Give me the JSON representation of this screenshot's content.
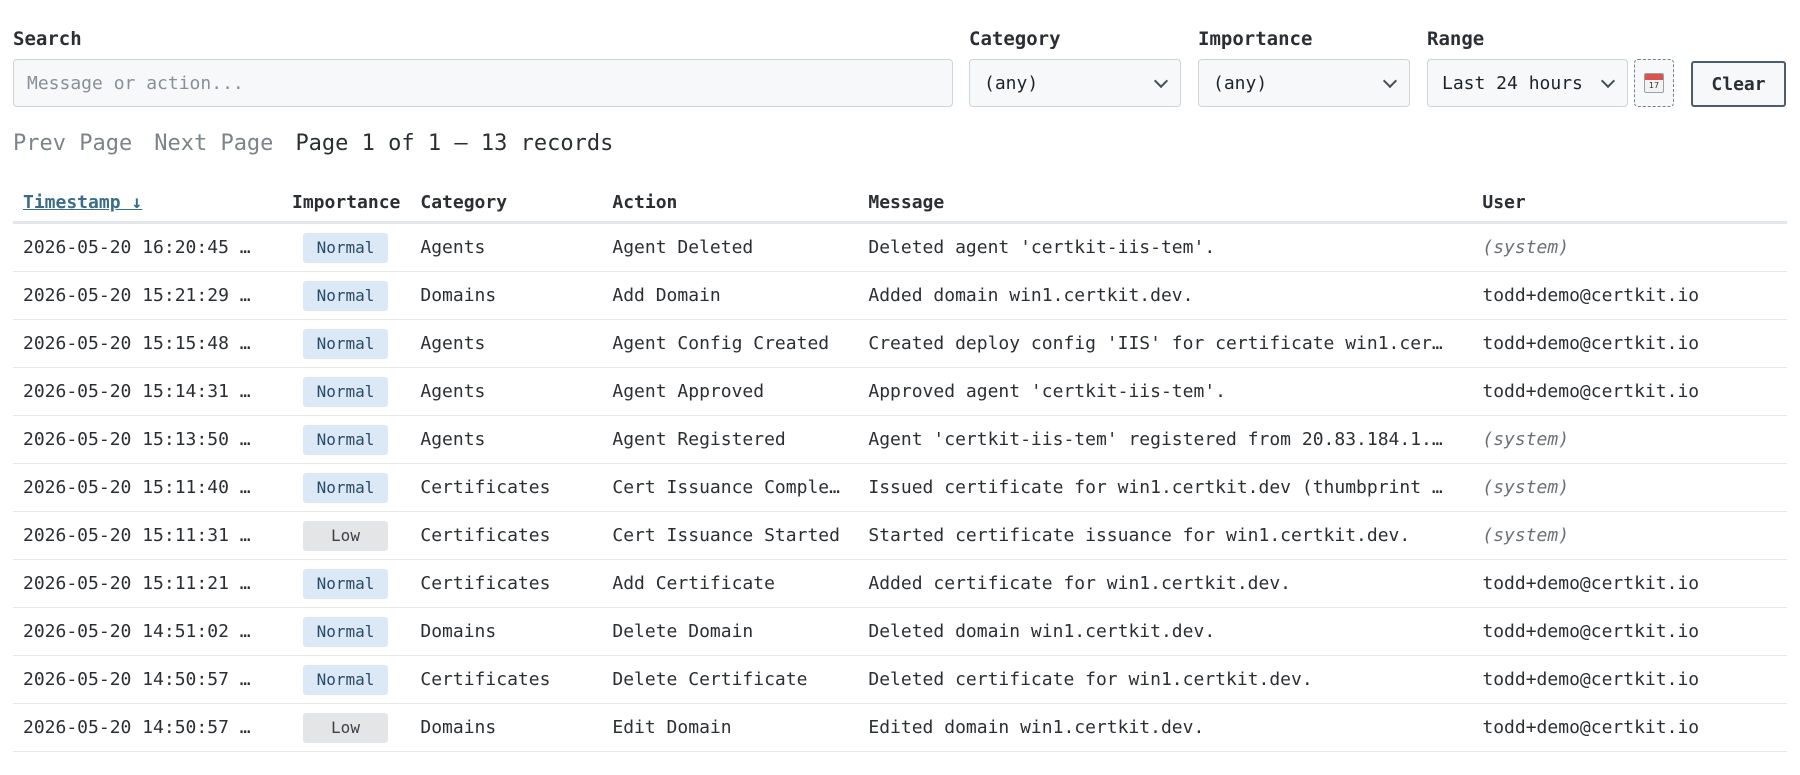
{
  "filters": {
    "search": {
      "label": "Search",
      "placeholder": "Message or action...",
      "value": ""
    },
    "category": {
      "label": "Category",
      "value": "(any)"
    },
    "importance": {
      "label": "Importance",
      "value": "(any)"
    },
    "range": {
      "label": "Range",
      "value": "Last 24 hours"
    },
    "calendar_icon": "calendar-icon",
    "calendar_day": "17",
    "clear_label": "Clear"
  },
  "pager": {
    "prev_label": "Prev Page",
    "next_label": "Next Page",
    "info": "Page 1 of 1 — 13 records"
  },
  "table": {
    "columns": [
      "Timestamp ↓",
      "Importance",
      "Category",
      "Action",
      "Message",
      "User"
    ],
    "rows": [
      {
        "timestamp": "2026-05-20 16:20:45 …",
        "importance": "Normal",
        "category": "Agents",
        "action": "Agent Deleted",
        "message": "Deleted agent 'certkit-iis-tem'.",
        "user": "(system)"
      },
      {
        "timestamp": "2026-05-20 15:21:29 …",
        "importance": "Normal",
        "category": "Domains",
        "action": "Add Domain",
        "message": "Added domain win1.certkit.dev.",
        "user": "todd+demo@certkit.io"
      },
      {
        "timestamp": "2026-05-20 15:15:48 …",
        "importance": "Normal",
        "category": "Agents",
        "action": "Agent Config Created",
        "message": "Created deploy config 'IIS' for certificate win1.cer…",
        "user": "todd+demo@certkit.io"
      },
      {
        "timestamp": "2026-05-20 15:14:31 …",
        "importance": "Normal",
        "category": "Agents",
        "action": "Agent Approved",
        "message": "Approved agent 'certkit-iis-tem'.",
        "user": "todd+demo@certkit.io"
      },
      {
        "timestamp": "2026-05-20 15:13:50 …",
        "importance": "Normal",
        "category": "Agents",
        "action": "Agent Registered",
        "message": "Agent 'certkit-iis-tem' registered from 20.83.184.1.…",
        "user": "(system)"
      },
      {
        "timestamp": "2026-05-20 15:11:40 …",
        "importance": "Normal",
        "category": "Certificates",
        "action": "Cert Issuance Comple…",
        "message": "Issued certificate for win1.certkit.dev (thumbprint …",
        "user": "(system)"
      },
      {
        "timestamp": "2026-05-20 15:11:31 …",
        "importance": "Low",
        "category": "Certificates",
        "action": "Cert Issuance Started",
        "message": "Started certificate issuance for win1.certkit.dev.",
        "user": "(system)"
      },
      {
        "timestamp": "2026-05-20 15:11:21 …",
        "importance": "Normal",
        "category": "Certificates",
        "action": "Add Certificate",
        "message": "Added certificate for win1.certkit.dev.",
        "user": "todd+demo@certkit.io"
      },
      {
        "timestamp": "2026-05-20 14:51:02 …",
        "importance": "Normal",
        "category": "Domains",
        "action": "Delete Domain",
        "message": "Deleted domain win1.certkit.dev.",
        "user": "todd+demo@certkit.io"
      },
      {
        "timestamp": "2026-05-20 14:50:57 …",
        "importance": "Normal",
        "category": "Certificates",
        "action": "Delete Certificate",
        "message": "Deleted certificate for win1.certkit.dev.",
        "user": "todd+demo@certkit.io"
      },
      {
        "timestamp": "2026-05-20 14:50:57 …",
        "importance": "Low",
        "category": "Domains",
        "action": "Edit Domain",
        "message": "Edited domain win1.certkit.dev.",
        "user": "todd+demo@certkit.io"
      }
    ]
  },
  "colors": {
    "badge_normal_bg": "#dbe9f7",
    "badge_low_bg": "#e4e5e7",
    "sorted_header": "#3b6d86"
  }
}
